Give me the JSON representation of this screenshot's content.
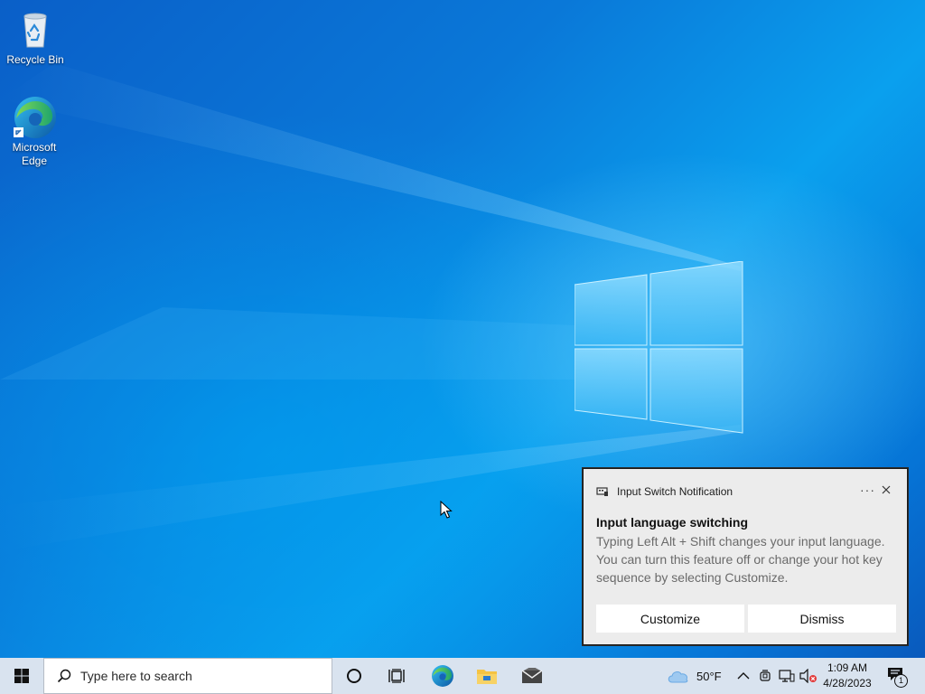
{
  "desktop": {
    "icons": [
      {
        "label": "Recycle Bin",
        "icon": "recycle-bin-icon"
      },
      {
        "label": "Microsoft Edge",
        "icon": "edge-icon"
      }
    ]
  },
  "toast": {
    "app_name": "Input Switch Notification",
    "more_label": "···",
    "title": "Input language switching",
    "body": "Typing Left Alt + Shift changes your input language. You can turn this feature off or change your hot key sequence by selecting Customize.",
    "buttons": [
      "Customize",
      "Dismiss"
    ]
  },
  "taskbar": {
    "search_placeholder": "Type here to search",
    "pinned": [
      "cortana-icon",
      "task-view-icon",
      "edge-icon",
      "file-explorer-icon",
      "mail-icon"
    ],
    "weather_temp": "50°F",
    "time": "1:09 AM",
    "date": "4/28/2023",
    "notification_count": "1"
  },
  "colors": {
    "accent": "#0078d7",
    "taskbar_bg": "#d9e3ef",
    "toast_bg": "#ececec"
  }
}
